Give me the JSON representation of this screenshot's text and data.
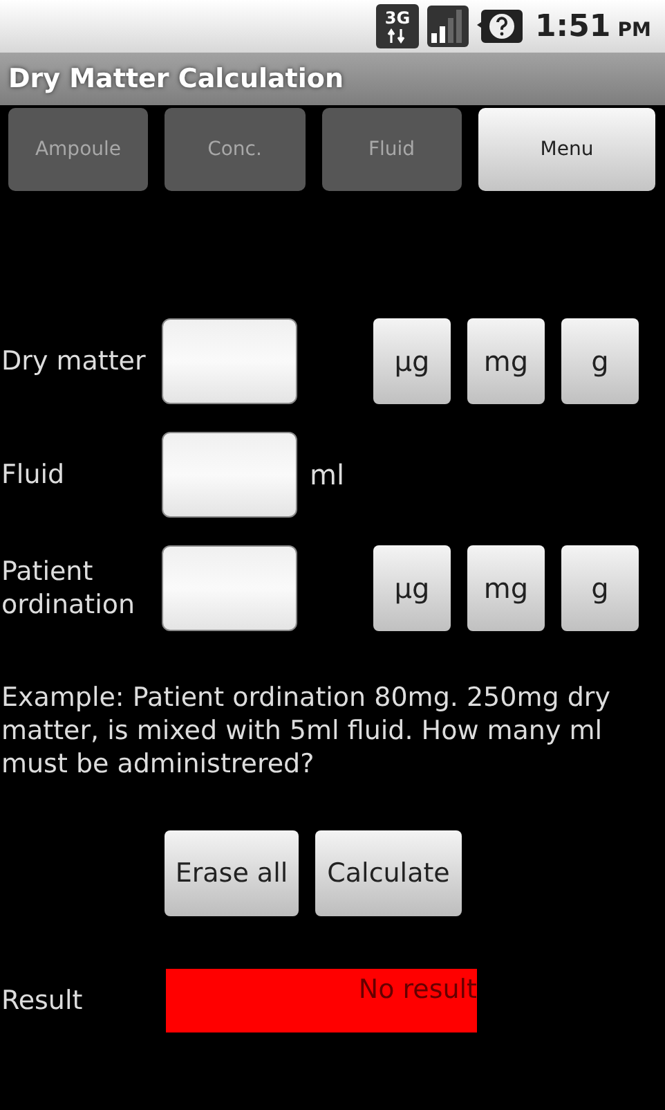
{
  "status_bar": {
    "network_type": "3G",
    "time": "1:51",
    "meridiem": "PM"
  },
  "window": {
    "title": "Dry Matter Calculation"
  },
  "tabs": [
    {
      "label": "Ampoule",
      "disabled": true
    },
    {
      "label": "Conc.",
      "disabled": true
    },
    {
      "label": "Fluid",
      "disabled": true
    },
    {
      "label": "Menu",
      "disabled": false
    }
  ],
  "fields": [
    {
      "label": "Dry matter",
      "kind": "units",
      "units": [
        "µg",
        "mg",
        "g"
      ]
    },
    {
      "label": "Fluid",
      "kind": "suffix",
      "suffix": "ml"
    },
    {
      "label": "Patient ordination",
      "kind": "units",
      "units": [
        "µg",
        "mg",
        "g"
      ]
    }
  ],
  "example": "Example: Patient ordination 80mg. 250mg dry matter, is mixed with 5ml fluid. How many ml must be administrered?",
  "buttons": [
    "Erase all",
    "Calculate"
  ],
  "result": {
    "label": "Result",
    "value": "No result"
  }
}
